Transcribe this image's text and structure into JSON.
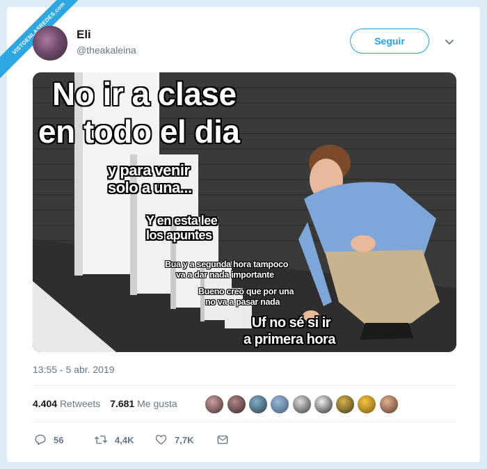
{
  "watermark": {
    "text": "VISTOENLASREDES",
    "subtext": ".com"
  },
  "user": {
    "name": "Eli",
    "handle": "@theakaleina"
  },
  "follow_label": "Seguir",
  "meme": {
    "captions": [
      "No ir a clase",
      "en todo el dia",
      "y para venir",
      "solo a una...",
      "Y en esta lee",
      "los apuntes",
      "Bua y a segunda hora tampoco",
      "va a dar nada importante",
      "Bueno creo que por una",
      "no va a pasar nada",
      "Uf no sé si ir",
      "a primera hora"
    ]
  },
  "timestamp": "13:55 - 5 abr. 2019",
  "stats": {
    "retweets_count": "4.404",
    "retweets_label": "Retweets",
    "likes_count": "7.681",
    "likes_label": "Me gusta"
  },
  "actions": {
    "replies": "56",
    "retweets": "4,4K",
    "likes": "7,7K"
  },
  "colors": {
    "accent": "#1da1f2",
    "muted": "#657786",
    "text": "#14171a",
    "ribbon": "#2ea7e0"
  },
  "icons": [
    "reply-icon",
    "retweet-icon",
    "like-icon",
    "message-icon",
    "chevron-down-icon"
  ]
}
